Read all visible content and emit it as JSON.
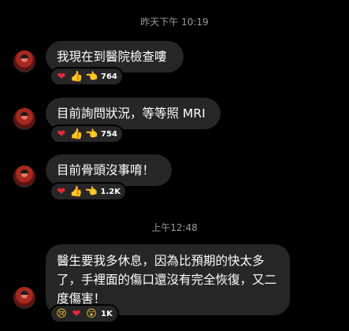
{
  "timestamps": {
    "first": "昨天下午 10:19",
    "second": "上午12:48"
  },
  "messages": [
    {
      "text": "我現在到醫院檢查嘍",
      "reactions": [
        "heart",
        "thumbs-up",
        "pointing-left"
      ],
      "count": "764"
    },
    {
      "text": "目前詢問狀況，等等照 MRI",
      "reactions": [
        "heart",
        "thumbs-up",
        "pointing-left"
      ],
      "count": "754"
    },
    {
      "text": "目前骨頭沒事唷！",
      "reactions": [
        "heart",
        "thumbs-up",
        "pointing-left"
      ],
      "count": "1.2K"
    },
    {
      "text": "醫生要我多休息，因為比預期的快太多了，手裡面的傷口還沒有完全恢復，又二度傷害！",
      "reactions": [
        "sad-face",
        "heart",
        "surprised-face"
      ],
      "count": "1K"
    }
  ],
  "colors": {
    "background": "#000000",
    "bubble": "#262626",
    "timestamp": "#9a9a9a",
    "heart": "#e8263a",
    "emoji_yellow": "#f3c33a"
  }
}
